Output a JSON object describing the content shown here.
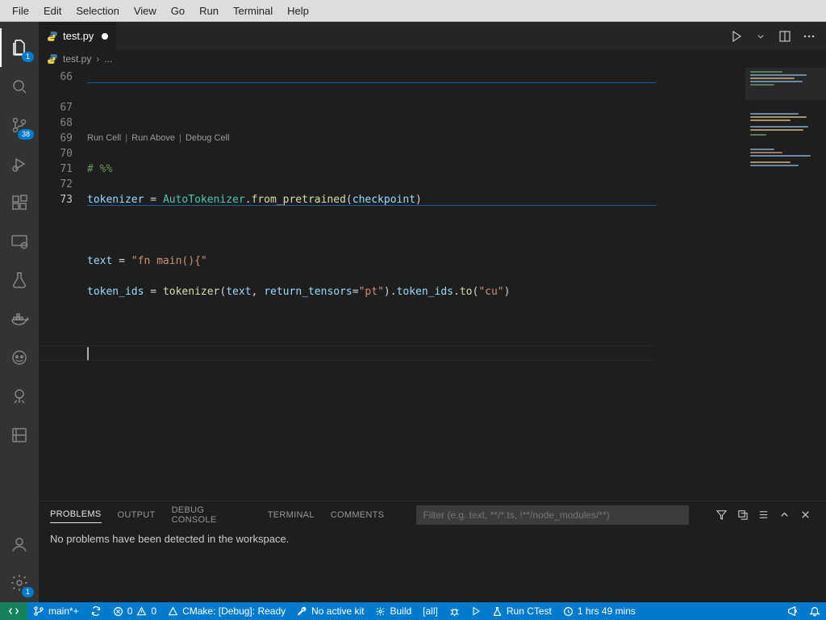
{
  "menubar": [
    "File",
    "Edit",
    "Selection",
    "View",
    "Go",
    "Run",
    "Terminal",
    "Help"
  ],
  "activitybar": {
    "explorer_badge": "1",
    "scm_badge": "38",
    "settings_badge": "1"
  },
  "tab": {
    "filename": "test.py",
    "dirty": true
  },
  "breadcrumb": {
    "file": "test.py",
    "symbol": "..."
  },
  "codelens": {
    "run_cell": "Run Cell",
    "run_above": "Run Above",
    "debug_cell": "Debug Cell"
  },
  "code": {
    "lines": [
      "66",
      "67",
      "68",
      "69",
      "70",
      "71",
      "72",
      "73"
    ],
    "l67_comment": "# %%",
    "l68_var": "tokenizer",
    "l68_eq": " = ",
    "l68_class": "AutoTokenizer",
    "l68_dot": ".",
    "l68_fn": "from_pretrained",
    "l68_op": "(",
    "l68_arg": "checkpoint",
    "l68_cl": ")",
    "l70_var": "text",
    "l70_eq": " = ",
    "l70_str": "\"fn main(){\"",
    "l71_var": "token_ids",
    "l71_eq": " = ",
    "l71_fn": "tokenizer",
    "l71_op1": "(",
    "l71_a1": "text",
    "l71_c1": ", ",
    "l71_kw": "return_tensors",
    "l71_ass": "=",
    "l71_s1": "\"pt\"",
    "l71_op2": ")",
    "l71_d1": ".",
    "l71_p1": "token_ids",
    "l71_d2": ".",
    "l71_fn2": "to",
    "l71_op3": "(",
    "l71_s2": "\"cu\"",
    "l71_op4": ")"
  },
  "panel": {
    "tabs": {
      "problems": "PROBLEMS",
      "output": "OUTPUT",
      "debug_console": "DEBUG CONSOLE",
      "terminal": "TERMINAL",
      "comments": "COMMENTS"
    },
    "filter_placeholder": "Filter (e.g. text, **/*.ts, !**/node_modules/**)",
    "body": "No problems have been detected in the workspace."
  },
  "statusbar": {
    "branch": "main*+",
    "errors": "0",
    "warnings": "0",
    "cmake": "CMake: [Debug]: Ready",
    "kit": "No active kit",
    "build": "Build",
    "target": "[all]",
    "run_ctest": "Run CTest",
    "time": "1 hrs 49 mins"
  },
  "colors": {
    "accent": "#007acc",
    "green": "#16825d"
  }
}
